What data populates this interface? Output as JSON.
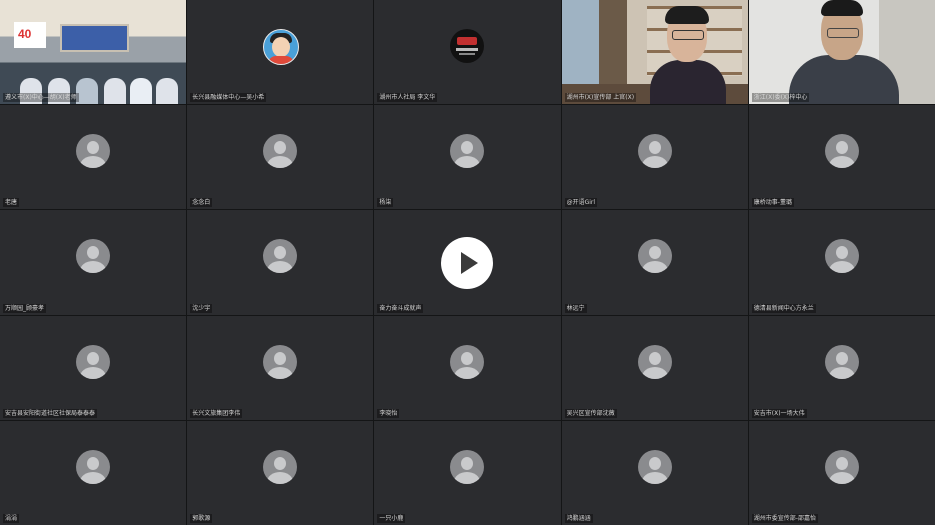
{
  "tiles": [
    {
      "name": "遵义市(X)中心—胡(X)老师",
      "kind": "classroom"
    },
    {
      "name": "长兴县融媒体中心—吴小希",
      "kind": "cartoon"
    },
    {
      "name": "湖州市人社局 李文华",
      "kind": "logo"
    },
    {
      "name": "湖州市(X)宣传部 上官(X)",
      "kind": "office"
    },
    {
      "name": "浙江(X)委(X)梓中心",
      "kind": "home"
    },
    {
      "name": "老唐",
      "kind": "placeholder"
    },
    {
      "name": "念念白",
      "kind": "placeholder"
    },
    {
      "name": "杨柒",
      "kind": "placeholder"
    },
    {
      "name": "@开语Girl",
      "kind": "placeholder"
    },
    {
      "name": "康桥动事-董璐",
      "kind": "placeholder"
    },
    {
      "name": "万顺园_顾豪孝",
      "kind": "placeholder"
    },
    {
      "name": "沈少宇",
      "kind": "placeholder"
    },
    {
      "name": "奋力奋斗成就声",
      "kind": "placeholder"
    },
    {
      "name": "林远宁",
      "kind": "placeholder"
    },
    {
      "name": "德清县新闻中心方永兰",
      "kind": "placeholder"
    },
    {
      "name": "安吉县安阳街道社区社保局泰泰泰",
      "kind": "placeholder"
    },
    {
      "name": "长兴文旅集团李伟",
      "kind": "placeholder"
    },
    {
      "name": "李晓怡",
      "kind": "placeholder"
    },
    {
      "name": "吴兴区宣传部沈薇",
      "kind": "placeholder"
    },
    {
      "name": "安吉市(X)一场大伟",
      "kind": "placeholder"
    },
    {
      "name": "涓涓",
      "kind": "placeholder"
    },
    {
      "name": "郭歌源",
      "kind": "placeholder"
    },
    {
      "name": "一只小鹿",
      "kind": "placeholder"
    },
    {
      "name": "鸿鹏涵涵",
      "kind": "placeholder"
    },
    {
      "name": "湖州市委宣传部-邵嘉怡",
      "kind": "placeholder"
    }
  ],
  "play_button": {
    "icon": "play-icon"
  }
}
